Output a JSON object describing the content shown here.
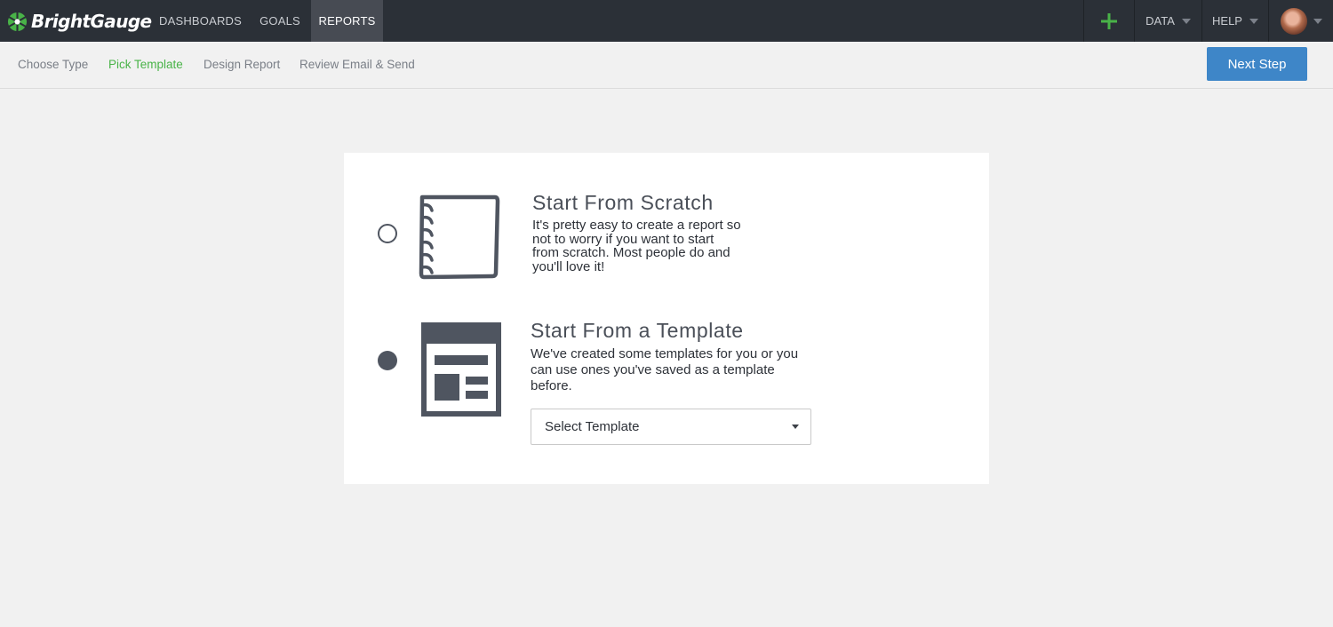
{
  "brand": {
    "name": "BrightGauge",
    "logo_icon": "gauge-wheel-icon",
    "accent": "#49b348"
  },
  "nav": [
    {
      "label": "DASHBOARDS",
      "active": false
    },
    {
      "label": "GOALS",
      "active": false
    },
    {
      "label": "REPORTS",
      "active": true
    }
  ],
  "nav_right": {
    "add_icon": "plus-icon",
    "data_label": "DATA",
    "help_label": "HELP",
    "avatar": "user-avatar"
  },
  "steps": [
    {
      "label": "Choose Type",
      "active": false
    },
    {
      "label": "Pick Template",
      "active": true
    },
    {
      "label": "Design Report",
      "active": false
    },
    {
      "label": "Review Email & Send",
      "active": false
    }
  ],
  "next_button": {
    "label": "Next Step",
    "color": "#3e86c8"
  },
  "options": [
    {
      "title": "Start From Scratch",
      "lines": [
        "It's pretty easy to create a report so",
        "not to worry if you want to start",
        "from scratch. Most people do and",
        "you'll love it!"
      ],
      "icon": "notebook-icon",
      "selected": false
    },
    {
      "title": "Start From a Template",
      "lines": [
        "We've created some templates for you or you",
        "can use ones you've saved as a template",
        "before."
      ],
      "icon": "template-layout-icon",
      "selected": true
    }
  ],
  "template_select": {
    "label": "Select Template"
  }
}
